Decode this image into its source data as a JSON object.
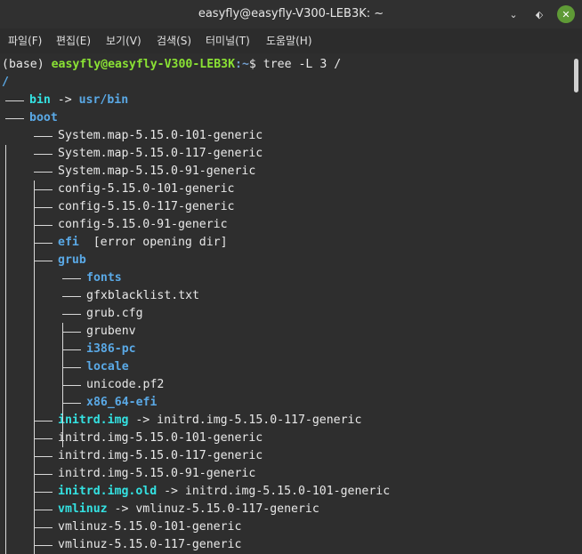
{
  "window": {
    "title": "easyfly@easyfly-V300-LEB3K: ~"
  },
  "menu": [
    {
      "label": "파일(F)"
    },
    {
      "label": "편집(E)"
    },
    {
      "label": "보기(V)"
    },
    {
      "label": "검색(S)"
    },
    {
      "label": "터미널(T)"
    },
    {
      "label": "도움말(H)"
    }
  ],
  "prompt": {
    "env": "(base) ",
    "user": "easyfly@easyfly-V300-LEB3K",
    "path": ":~",
    "symbol": "$ ",
    "command": "tree -L 3 /"
  },
  "root": "/",
  "entries": [
    {
      "name": "bin",
      "kind": "link",
      "arrow": " -> ",
      "target": "usr/bin",
      "target_kind": "dir"
    },
    {
      "name": "boot",
      "kind": "dir"
    },
    {
      "name": "System.map-5.15.0-101-generic",
      "kind": "file"
    },
    {
      "name": "System.map-5.15.0-117-generic",
      "kind": "file"
    },
    {
      "name": "System.map-5.15.0-91-generic",
      "kind": "file"
    },
    {
      "name": "config-5.15.0-101-generic",
      "kind": "file"
    },
    {
      "name": "config-5.15.0-117-generic",
      "kind": "file"
    },
    {
      "name": "config-5.15.0-91-generic",
      "kind": "file"
    },
    {
      "name": "efi",
      "kind": "dir",
      "note": "  [error opening dir]"
    },
    {
      "name": "grub",
      "kind": "dir"
    },
    {
      "name": "fonts",
      "kind": "dir"
    },
    {
      "name": "gfxblacklist.txt",
      "kind": "file"
    },
    {
      "name": "grub.cfg",
      "kind": "file"
    },
    {
      "name": "grubenv",
      "kind": "file"
    },
    {
      "name": "i386-pc",
      "kind": "dir"
    },
    {
      "name": "locale",
      "kind": "dir"
    },
    {
      "name": "unicode.pf2",
      "kind": "file"
    },
    {
      "name": "x86_64-efi",
      "kind": "dir"
    },
    {
      "name": "initrd.img",
      "kind": "link",
      "arrow": " -> ",
      "target": "initrd.img-5.15.0-117-generic",
      "target_kind": "file"
    },
    {
      "name": "initrd.img-5.15.0-101-generic",
      "kind": "file"
    },
    {
      "name": "initrd.img-5.15.0-117-generic",
      "kind": "file"
    },
    {
      "name": "initrd.img-5.15.0-91-generic",
      "kind": "file"
    },
    {
      "name": "initrd.img.old",
      "kind": "link",
      "arrow": " -> ",
      "target": "initrd.img-5.15.0-101-generic",
      "target_kind": "file"
    },
    {
      "name": "vmlinuz",
      "kind": "link",
      "arrow": " -> ",
      "target": "vmlinuz-5.15.0-117-generic",
      "target_kind": "file"
    },
    {
      "name": "vmlinuz-5.15.0-101-generic",
      "kind": "file"
    },
    {
      "name": "vmlinuz-5.15.0-117-generic",
      "kind": "file"
    }
  ],
  "colors": {
    "background": "#2e2e2e",
    "prompt_user": "#8ae234",
    "prompt_path": "#729fcf",
    "directory": "#5aa9e6",
    "symlink": "#34e2e2",
    "close_button": "#5f9a36"
  },
  "icons": [
    "minimize-icon",
    "maximize-icon",
    "close-icon"
  ]
}
